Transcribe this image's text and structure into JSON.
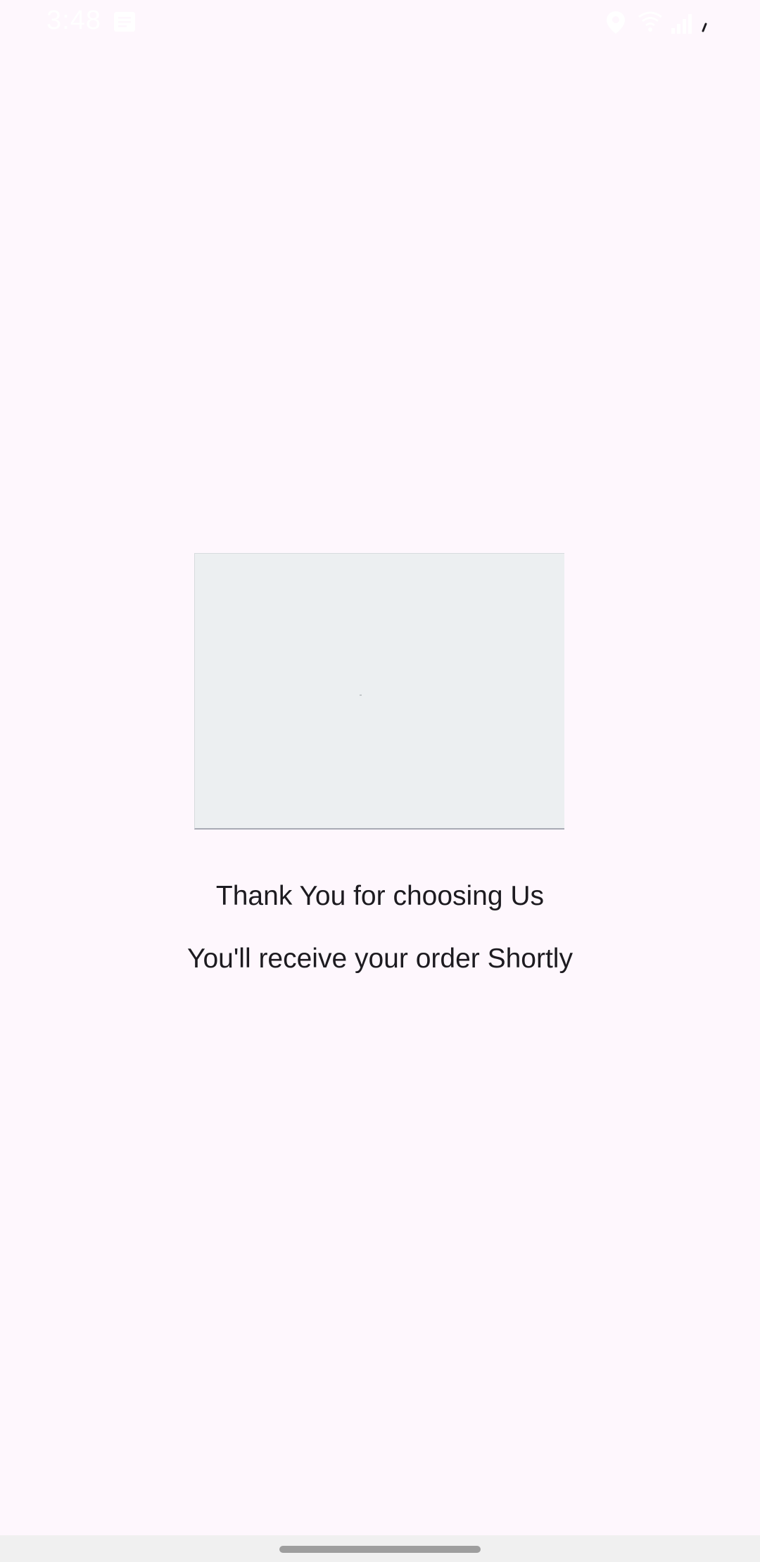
{
  "status_bar": {
    "time": "3:48",
    "icons": [
      "notification-icon",
      "location-icon",
      "wifi-icon",
      "signal-icon",
      "battery-icon"
    ]
  },
  "confirmation": {
    "image": "order-confirmation-image-placeholder",
    "title": "Thank You for choosing Us",
    "subtitle": "You'll receive your order Shortly"
  },
  "colors": {
    "background": "#fef7fd",
    "text": "#1d1b20",
    "placeholder": "#eceff1",
    "nav_bar": "#f0f0f0",
    "home_handle": "#9e9e9e"
  }
}
